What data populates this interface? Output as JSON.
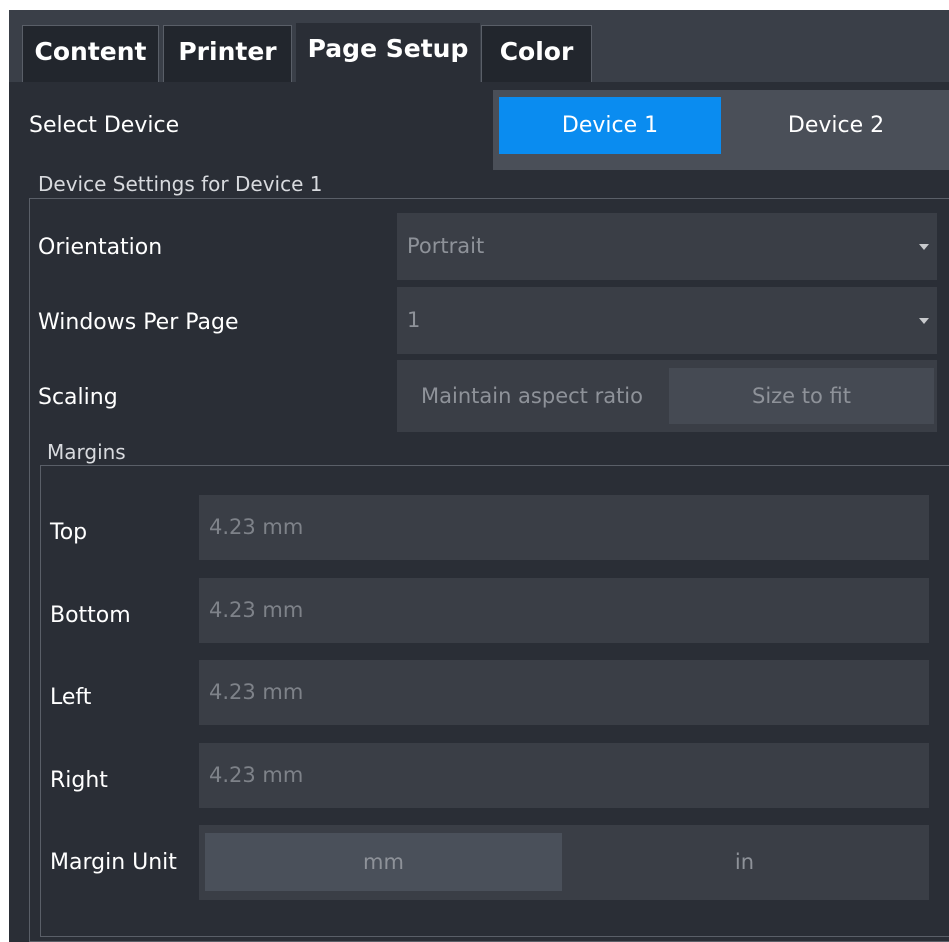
{
  "tabs": [
    {
      "label": "Content"
    },
    {
      "label": "Printer"
    },
    {
      "label": "Page Setup"
    },
    {
      "label": "Color"
    }
  ],
  "active_tab": "Page Setup",
  "select_device": {
    "label": "Select Device",
    "options": [
      "Device 1",
      "Device 2"
    ],
    "selected": "Device 1"
  },
  "device_settings": {
    "title": "Device Settings for Device 1",
    "orientation": {
      "label": "Orientation",
      "value": "Portrait"
    },
    "windows_per_page": {
      "label": "Windows Per Page",
      "value": "1"
    },
    "scaling": {
      "label": "Scaling",
      "options": [
        "Maintain aspect ratio",
        "Size to fit"
      ]
    },
    "margins": {
      "title": "Margins",
      "top": {
        "label": "Top",
        "value": "4.23 mm"
      },
      "bottom": {
        "label": "Bottom",
        "value": "4.23 mm"
      },
      "left": {
        "label": "Left",
        "value": "4.23 mm"
      },
      "right": {
        "label": "Right",
        "value": "4.23 mm"
      },
      "unit": {
        "label": "Margin Unit",
        "options": [
          "mm",
          "in"
        ],
        "selected": "mm"
      }
    }
  },
  "colors": {
    "accent": "#0a8cf0",
    "panel": "#2a2e36",
    "field": "#3a3e46"
  }
}
